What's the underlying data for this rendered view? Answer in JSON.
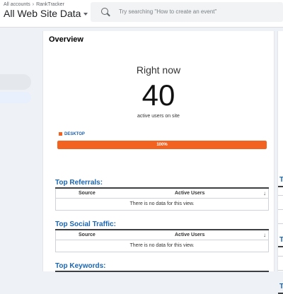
{
  "header": {
    "breadcrumb": [
      "All accounts",
      "RankTracker"
    ],
    "breadcrumb_separator": "›",
    "property_title": "All Web Site Data",
    "search_placeholder": "Try searching \"How to create an event\""
  },
  "overview": {
    "title": "Overview",
    "right_now_label": "Right now",
    "active_users": "40",
    "active_users_caption": "active users on site",
    "device": {
      "label": "DESKTOP",
      "percent_label": "100%",
      "fraction": 1.0,
      "color": "#f26322"
    }
  },
  "reports": [
    {
      "title": "Top Referrals:",
      "col_source": "Source",
      "col_active": "Active Users",
      "sort_icon": "↓",
      "empty_message": "There is no data for this view."
    },
    {
      "title": "Top Social Traffic:",
      "col_source": "Source",
      "col_active": "Active Users",
      "sort_icon": "↓",
      "empty_message": "There is no data for this view."
    },
    {
      "title": "Top Keywords:"
    }
  ],
  "right_edge": {
    "heading_1": "T",
    "heading_2": "T",
    "heading_3": "T"
  },
  "colors": {
    "link_blue": "#1a66b2",
    "desktop_orange": "#f26322"
  }
}
